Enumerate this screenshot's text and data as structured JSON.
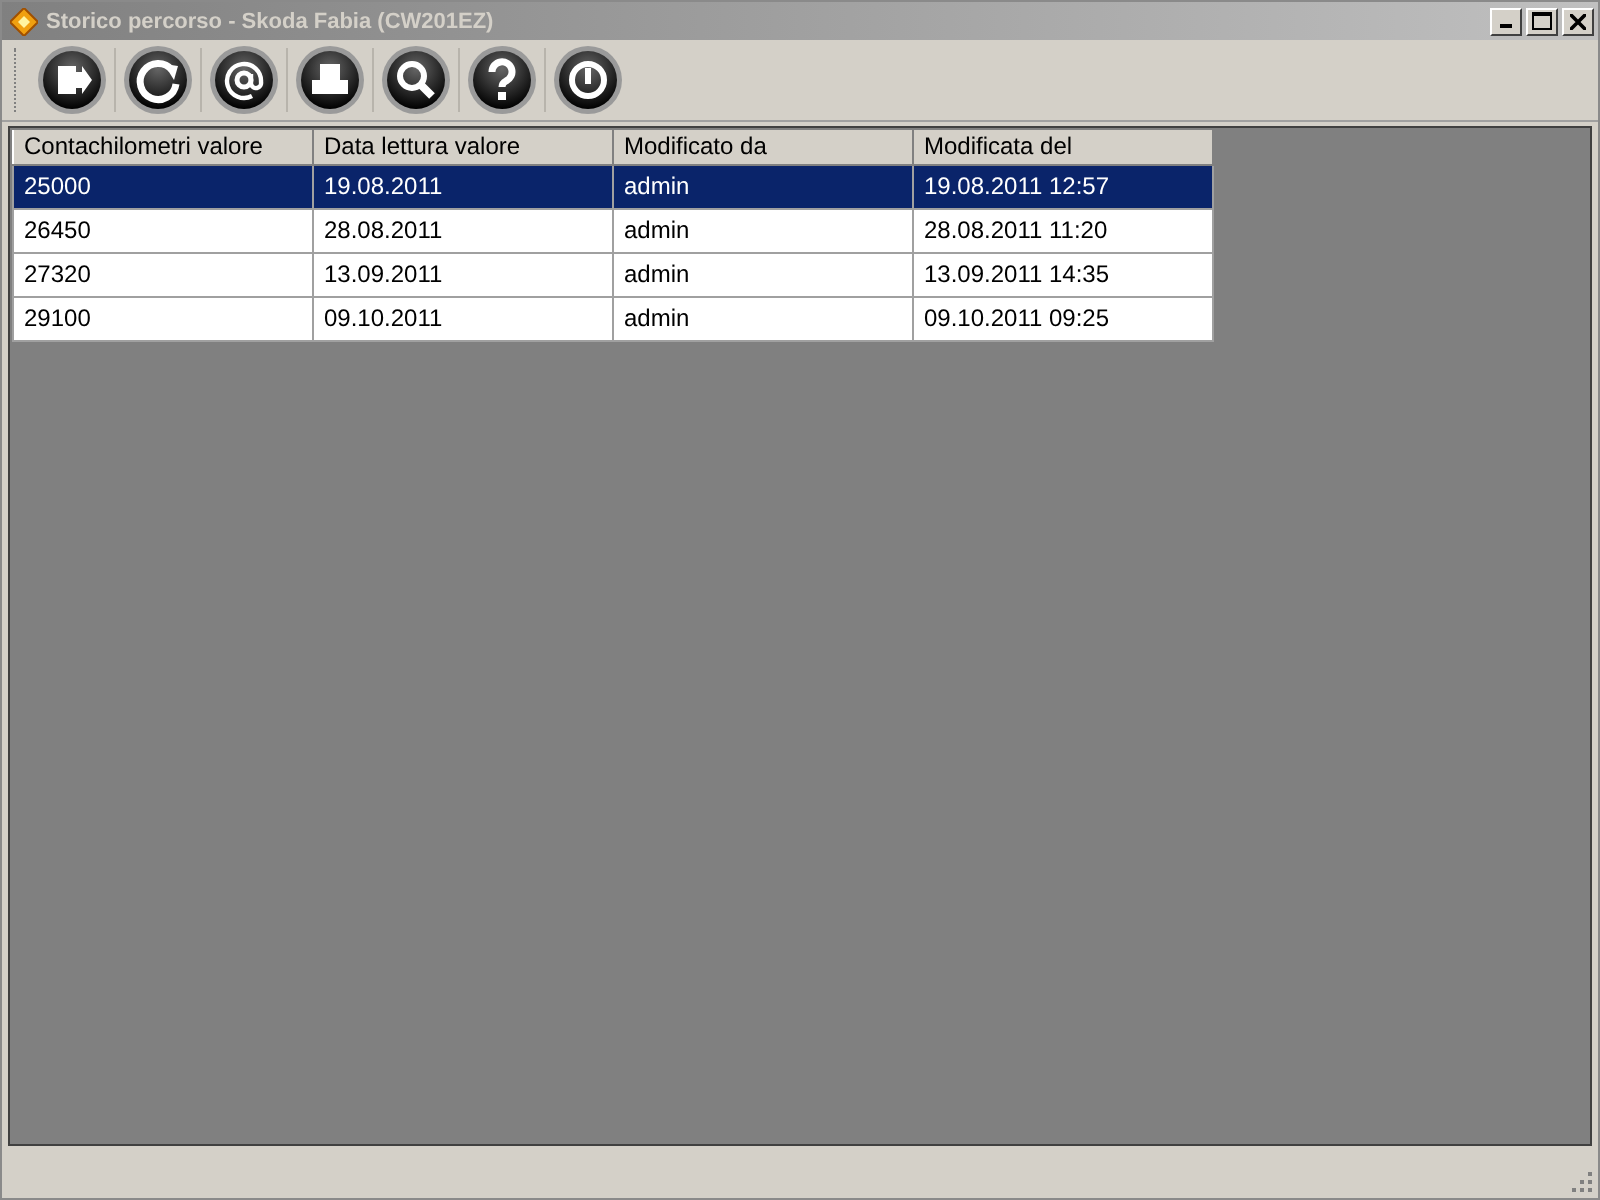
{
  "window": {
    "title": "Storico percorso - Skoda Fabia (CW201EZ)",
    "active": false
  },
  "toolbar": [
    {
      "kind": "exit"
    },
    {
      "kind": "refresh"
    },
    {
      "kind": "email"
    },
    {
      "kind": "print"
    },
    {
      "kind": "search"
    },
    {
      "kind": "help"
    },
    {
      "kind": "power"
    }
  ],
  "table": {
    "columns": [
      "Contachilometri valore",
      "Data lettura valore",
      "Modificato da",
      "Modificata del"
    ],
    "rows": [
      {
        "cells": [
          "25000",
          "19.08.2011",
          "admin",
          "19.08.2011 12:57"
        ],
        "selected": true
      },
      {
        "cells": [
          "26450",
          "28.08.2011",
          "admin",
          "28.08.2011 11:20"
        ],
        "selected": false
      },
      {
        "cells": [
          "27320",
          "13.09.2011",
          "admin",
          "13.09.2011 14:35"
        ],
        "selected": false
      },
      {
        "cells": [
          "29100",
          "09.10.2011",
          "admin",
          "09.10.2011 09:25"
        ],
        "selected": false
      }
    ]
  }
}
